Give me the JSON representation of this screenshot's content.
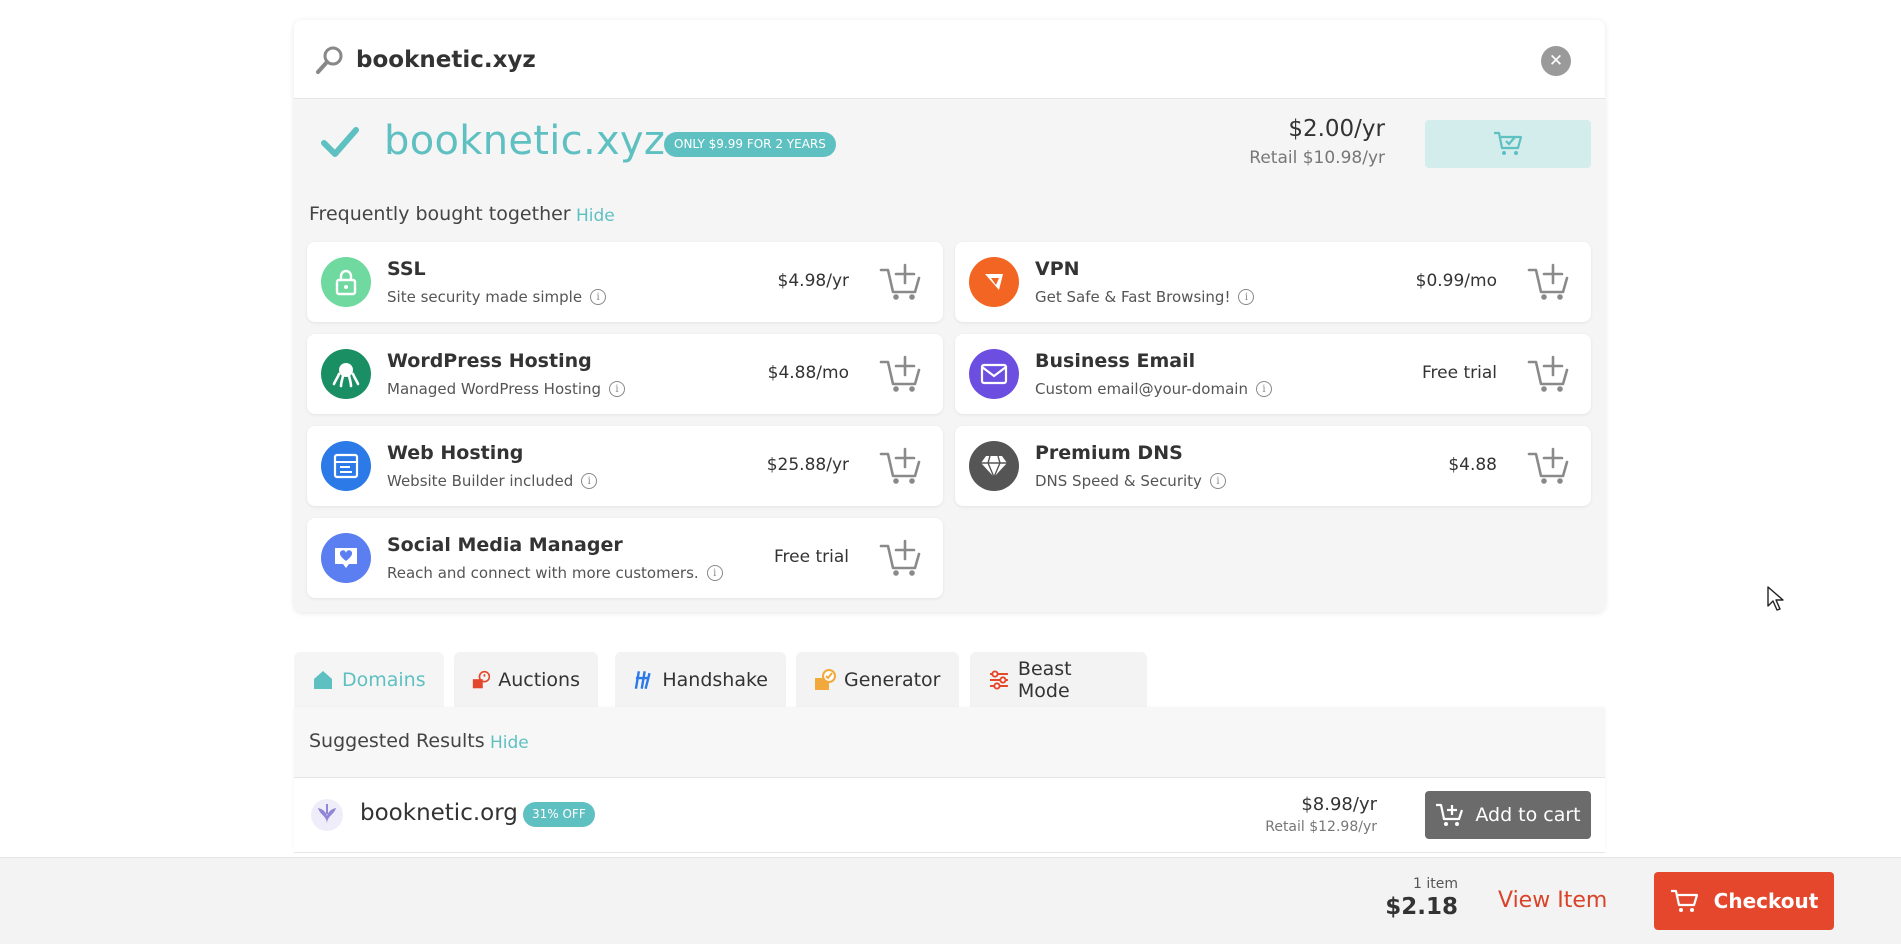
{
  "search": {
    "value": "booknetic.xyz",
    "placeholder": ""
  },
  "main_result": {
    "domain": "booknetic.xyz",
    "promo": "ONLY $9.99 FOR 2 YEARS",
    "price": "$2.00/yr",
    "retail": "Retail $10.98/yr"
  },
  "frequently_bought": {
    "label": "Frequently bought together",
    "hide": "Hide",
    "products": [
      {
        "name": "SSL",
        "desc": "Site security made simple",
        "price": "$4.98/yr",
        "icon": "lock-icon",
        "color": "#6fd99f"
      },
      {
        "name": "VPN",
        "desc": "Get Safe & Fast Browsing!",
        "price": "$0.99/mo",
        "icon": "vpn-icon",
        "color": "#f26522"
      },
      {
        "name": "WordPress Hosting",
        "desc": "Managed WordPress Hosting",
        "price": "$4.88/mo",
        "icon": "octopus-icon",
        "color": "#1a8f63"
      },
      {
        "name": "Business Email",
        "desc": "Custom email@your-domain",
        "price": "Free trial",
        "icon": "envelope-icon",
        "color": "#6c4fe0"
      },
      {
        "name": "Web Hosting",
        "desc": "Website Builder included",
        "price": "$25.88/yr",
        "icon": "hosting-icon",
        "color": "#2c79e8"
      },
      {
        "name": "Premium DNS",
        "desc": "DNS Speed & Security",
        "price": "$4.88",
        "icon": "diamond-icon",
        "color": "#555555"
      },
      {
        "name": "Social Media Manager",
        "desc": "Reach and connect with more customers.",
        "price": "Free trial",
        "icon": "heart-chat-icon",
        "color": "#5b7ef0"
      }
    ]
  },
  "tabs": [
    {
      "label": "Domains",
      "icon": "home-icon",
      "active": true
    },
    {
      "label": "Auctions",
      "icon": "auction-icon",
      "active": false
    },
    {
      "label": "Handshake",
      "icon": "handshake-icon",
      "active": false
    },
    {
      "label": "Generator",
      "icon": "generator-icon",
      "active": false
    },
    {
      "label": "Beast Mode",
      "icon": "sliders-icon",
      "active": false
    }
  ],
  "suggested": {
    "label": "Suggested Results",
    "hide": "Hide",
    "rows": [
      {
        "domain": "booknetic.org",
        "badge": "31% OFF",
        "price": "$8.98/yr",
        "retail": "Retail $12.98/yr",
        "button": "Add to cart"
      }
    ]
  },
  "cart_bar": {
    "count": "1 item",
    "total": "$2.18",
    "view_item": "View Item",
    "checkout": "Checkout"
  },
  "colors": {
    "accent_teal": "#5fc0c2",
    "checkout_red": "#e5472c",
    "add_cart_gray": "#6b6b6b"
  }
}
